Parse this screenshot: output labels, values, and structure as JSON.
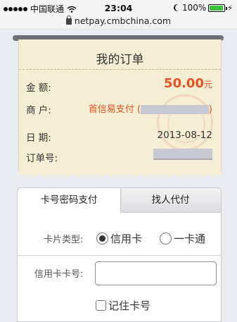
{
  "status_bar": {
    "carrier": "中国联通",
    "time": "23:04",
    "battery": "100%",
    "icons": [
      "signal-dots-icon",
      "wifi-icon",
      "moon-icon",
      "battery-icon",
      "charging-bolt-icon"
    ]
  },
  "browser": {
    "url": "netpay.cmbchina.com",
    "icon": "lock-icon"
  },
  "order": {
    "title": "我的订单",
    "amount_label": "金    额:",
    "amount_value": "50.00",
    "amount_unit": "元",
    "merchant_label": "商    户:",
    "merchant_value": "首信易支付 (",
    "merchant_suffix": ")",
    "date_label": "日    期:",
    "date_value": "2013-08-12",
    "order_no_label": "订单号:"
  },
  "tabs": [
    {
      "label": "卡号密码支付",
      "active": true
    },
    {
      "label": "找人代付",
      "active": false
    }
  ],
  "form": {
    "card_type_label": "卡片类型:",
    "card_type_options": [
      {
        "label": "信用卡",
        "checked": true
      },
      {
        "label": "一卡通",
        "checked": false
      }
    ],
    "card_no_label": "信用卡卡号:",
    "card_no_value": "",
    "remember_label": "记住卡号",
    "remember_checked": false
  },
  "colors": {
    "accent": "#e8521d",
    "receipt_bg": "#f5edd4",
    "page_bg": "#e8ebef"
  }
}
